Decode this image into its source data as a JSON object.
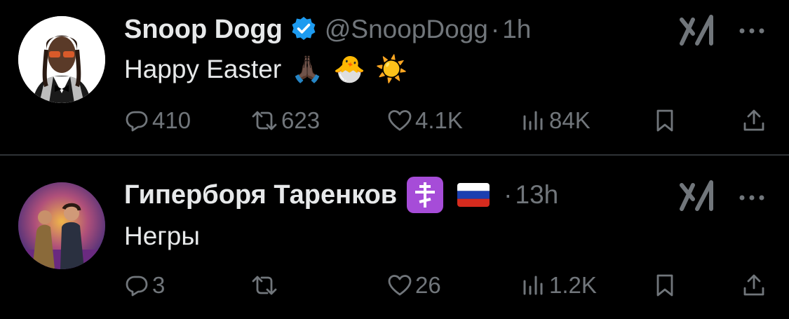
{
  "tweets": [
    {
      "name": "Snoop Dogg",
      "handle": "@SnoopDogg",
      "sep": "·",
      "time": "1h",
      "text": "Happy Easter",
      "emojis": [
        "🙏🏿",
        "🐣",
        "☀️"
      ],
      "verified": true,
      "stats": {
        "replies": "410",
        "reposts": "623",
        "likes": "4.1K",
        "views": "84K"
      }
    },
    {
      "name": "Гиперборя Таренков",
      "badge_icon": "orthodox-cross-icon",
      "flag": "russia-flag",
      "sep": "·",
      "time": "13h",
      "text": "Негры",
      "stats": {
        "replies": "3",
        "reposts": "",
        "likes": "26",
        "views": "1.2K"
      }
    }
  ],
  "colors": {
    "background": "#000000",
    "text": "#e7e9ea",
    "muted": "#71767b",
    "verified": "#1d9bf0",
    "divider": "#2f3336"
  }
}
